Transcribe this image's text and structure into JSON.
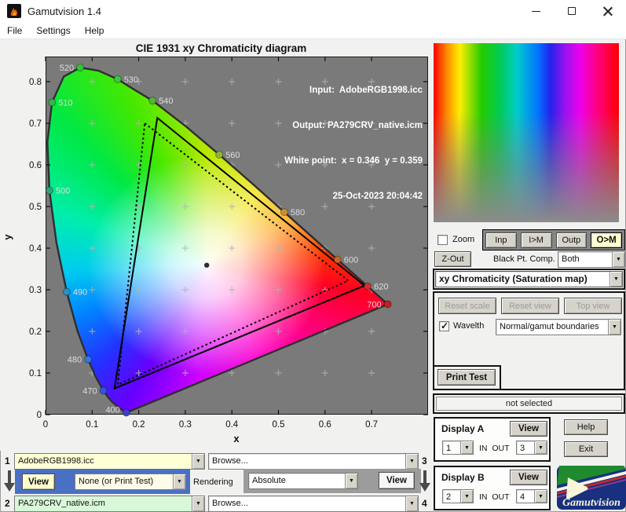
{
  "window": {
    "title": "Gamutvision 1.4",
    "menu": [
      "File",
      "Settings",
      "Help"
    ]
  },
  "colors": {
    "plot_background": "#7a7a7a",
    "button_face": "#d6d3ca",
    "highlight_yellow": "#ffffd0",
    "panel_blue": "#4a70c4",
    "panel_gray": "#9c9c9c",
    "profile1_field": "#ffffd6",
    "profile2_field": "#d9f7d9",
    "operation_field": "#fcfce8",
    "client_background": "#f1f1f0",
    "logo_blue": "#18307d"
  },
  "chart": {
    "title": "CIE 1931 xy Chromaticity diagram",
    "annotation": {
      "input": "Input:  AdobeRGB1998.icc",
      "output": "Output: PA279CRV_native.icm",
      "white_point": "White point:  x = 0.346  y = 0.359",
      "timestamp": "25-Oct-2023 20:04:42"
    },
    "xlabel": "x",
    "ylabel": "y",
    "chart_data": {
      "type": "scatter",
      "title": "CIE 1931 xy Chromaticity diagram",
      "xlabel": "x",
      "ylabel": "y",
      "xlim": [
        0,
        0.82
      ],
      "ylim": [
        0,
        0.86
      ],
      "x_ticks": [
        0,
        0.1,
        0.2,
        0.3,
        0.4,
        0.5,
        0.6,
        0.7
      ],
      "y_ticks": [
        0,
        0.1,
        0.2,
        0.3,
        0.4,
        0.5,
        0.6,
        0.7,
        0.8
      ],
      "grid_marks": {
        "x": [
          0.1,
          0.2,
          0.3,
          0.4,
          0.5,
          0.6,
          0.7
        ],
        "y": [
          0.1,
          0.2,
          0.3,
          0.4,
          0.5,
          0.6,
          0.7,
          0.8
        ]
      },
      "white_point": {
        "x": 0.346,
        "y": 0.359
      },
      "spectral_locus": [
        [
          0.1741,
          0.005
        ],
        [
          0.1714,
          0.005
        ],
        [
          0.1689,
          0.0069
        ],
        [
          0.1644,
          0.0109
        ],
        [
          0.1566,
          0.0177
        ],
        [
          0.144,
          0.0297
        ],
        [
          0.1355,
          0.0399
        ],
        [
          0.1241,
          0.0578
        ],
        [
          0.1096,
          0.0868
        ],
        [
          0.0913,
          0.1327
        ],
        [
          0.0687,
          0.2007
        ],
        [
          0.0454,
          0.295
        ],
        [
          0.0235,
          0.4127
        ],
        [
          0.0082,
          0.5384
        ],
        [
          0.0039,
          0.6548
        ],
        [
          0.0139,
          0.7502
        ],
        [
          0.0389,
          0.812
        ],
        [
          0.0743,
          0.8338
        ],
        [
          0.1142,
          0.8262
        ],
        [
          0.1547,
          0.8059
        ],
        [
          0.1896,
          0.7816
        ],
        [
          0.2296,
          0.7543
        ],
        [
          0.3016,
          0.6923
        ],
        [
          0.3731,
          0.6245
        ],
        [
          0.4441,
          0.5547
        ],
        [
          0.5125,
          0.4866
        ],
        [
          0.5752,
          0.4242
        ],
        [
          0.627,
          0.3725
        ],
        [
          0.6658,
          0.334
        ],
        [
          0.6915,
          0.3083
        ],
        [
          0.719,
          0.2809
        ],
        [
          0.7347,
          0.2653
        ]
      ],
      "wavelength_markers": [
        {
          "nm": 400,
          "x": 0.1733,
          "y": 0.0048,
          "color": "#4040c8",
          "side": "left",
          "dy": -4
        },
        {
          "nm": 470,
          "x": 0.1241,
          "y": 0.0578,
          "color": "#3355dd",
          "side": "left",
          "dy": 0
        },
        {
          "nm": 480,
          "x": 0.0913,
          "y": 0.1327,
          "color": "#3377dd",
          "side": "left",
          "dy": 0
        },
        {
          "nm": 490,
          "x": 0.0454,
          "y": 0.295,
          "color": "#2e8fc0",
          "side": "right",
          "dy": 0
        },
        {
          "nm": 500,
          "x": 0.0082,
          "y": 0.5384,
          "color": "#2aa87a",
          "side": "right",
          "dy": 0
        },
        {
          "nm": 510,
          "x": 0.0139,
          "y": 0.7502,
          "color": "#30b84a",
          "side": "right",
          "dy": 0
        },
        {
          "nm": 520,
          "x": 0.0743,
          "y": 0.8338,
          "color": "#2ec82e",
          "side": "left",
          "dy": 0
        },
        {
          "nm": 530,
          "x": 0.1547,
          "y": 0.8059,
          "color": "#3cc83c",
          "side": "right",
          "dy": 0
        },
        {
          "nm": 540,
          "x": 0.2296,
          "y": 0.7543,
          "color": "#52b43c",
          "side": "right",
          "dy": 0
        },
        {
          "nm": 560,
          "x": 0.3731,
          "y": 0.6245,
          "color": "#8cb43c",
          "side": "right",
          "dy": 0
        },
        {
          "nm": 580,
          "x": 0.5125,
          "y": 0.4866,
          "color": "#c88f32",
          "side": "right",
          "dy": 0
        },
        {
          "nm": 600,
          "x": 0.627,
          "y": 0.3725,
          "color": "#c86428",
          "side": "right",
          "dy": 0
        },
        {
          "nm": 620,
          "x": 0.6915,
          "y": 0.3083,
          "color": "#cc3232",
          "side": "right",
          "dy": 0
        },
        {
          "nm": 700,
          "x": 0.7347,
          "y": 0.2653,
          "color": "#c01f1f",
          "side": "left",
          "dy": 0
        }
      ],
      "gamut_triangles": [
        {
          "name": "output-gamut-solid",
          "style": "solid",
          "points": [
            [
              0.24,
              0.713
            ],
            [
              0.685,
              0.31
            ],
            [
              0.148,
              0.063
            ]
          ]
        },
        {
          "name": "input-gamut-dotted",
          "style": "dotted",
          "points": [
            [
              0.213,
              0.7
            ],
            [
              0.65,
              0.322
            ],
            [
              0.155,
              0.072
            ]
          ]
        }
      ]
    }
  },
  "side_panel": {
    "zoom_checkbox": {
      "label": "Zoom",
      "checked": false
    },
    "profile_buttons": [
      {
        "label": "Inp",
        "active": false
      },
      {
        "label": "I>M",
        "active": false
      },
      {
        "label": "Outp",
        "active": false
      },
      {
        "label": "O>M",
        "active": true
      }
    ],
    "zout_button": "Z-Out",
    "black_pt_label": "Black Pt. Comp.",
    "black_pt_value": "Both",
    "view_mode_value": "xy Chromaticity (Saturation map)",
    "reset_buttons": [
      "Reset scale",
      "Reset view",
      "Top view"
    ],
    "wavelth_checkbox": {
      "label": "Wavelth",
      "checked": true
    },
    "boundaries_value": "Normal/gamut boundaries",
    "print_test_button": "Print Test",
    "status": "not selected",
    "display_a": {
      "title": "Display A",
      "view_button": "View",
      "in_value": "1",
      "inout_label": "IN  OUT",
      "out_value": "3"
    },
    "display_b": {
      "title": "Display B",
      "view_button": "View",
      "in_value": "2",
      "inout_label": "IN  OUT",
      "out_value": "4"
    },
    "help_button": "Help",
    "exit_button": "Exit",
    "logo_text": "Gamutvision"
  },
  "bottom_bar": {
    "num1": "1",
    "num2": "2",
    "num3": "3",
    "num4": "4",
    "profile1": "AdobeRGB1998.icc",
    "profile2": "PA279CRV_native.icm",
    "browse1": "Browse...",
    "browse2": "Browse...",
    "view_left": "View",
    "view_right": "View",
    "operation_value": "None (or Print Test)",
    "rendering_label": "Rendering",
    "rendering_value": "Absolute"
  }
}
